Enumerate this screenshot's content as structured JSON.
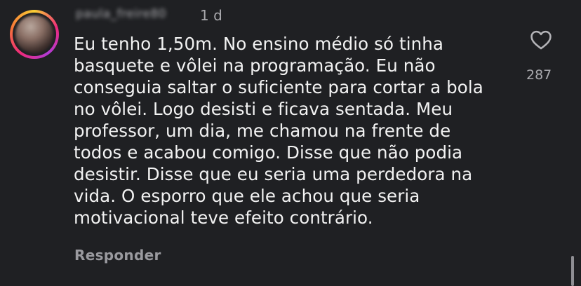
{
  "comment": {
    "username": "paula_freire80",
    "time": "1 d",
    "text": "Eu tenho 1,50m. No ensino médio só tinha\nbasquete e vôlei na programação. Eu não\nconseguia saltar o suficiente para cortar a bola\nno vôlei. Logo desisti e ficava sentada. Meu\nprofessor,  um dia, me chamou na frente de\ntodos e acabou comigo. Disse que não podia\ndesistir. Disse que eu seria uma perdedora na\nvida. O esporro que ele achou que seria\nmotivacional teve efeito contrário.",
    "reply_label": "Responder",
    "like_count": "287",
    "like_icon": "heart-outline-icon"
  },
  "colors": {
    "background": "#1f2023",
    "text": "#f2f2f2",
    "secondary_text": "#a9a9ad"
  }
}
